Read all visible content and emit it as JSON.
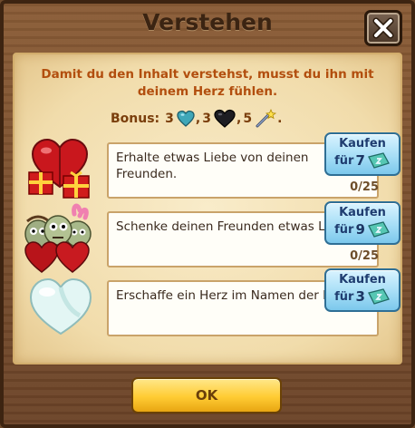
{
  "dialog": {
    "title": "Verstehen",
    "close_icon": "close-icon",
    "intro_text": "Damit du den Inhalt verstehst, musst du ihn mit deinem Herz fühlen.",
    "bonus": {
      "label": "Bonus:",
      "items": [
        {
          "amount": "3",
          "icon": "blue-heart-icon"
        },
        {
          "amount": "3",
          "icon": "black-heart-icon"
        },
        {
          "amount": "5",
          "icon": "magic-wand-icon"
        }
      ],
      "separator": ",",
      "end": "."
    },
    "tasks": [
      {
        "description": "Erhalte etwas Liebe von deinen Freunden.",
        "buy_label": "Kaufen",
        "buy_for": "für",
        "price": "7",
        "currency_icon": "cash-ticket-icon",
        "progress": "0/25",
        "icon": "hearts-gifts-icon"
      },
      {
        "description": "Schenke deinen Freunden etwas Liebe.",
        "buy_label": "Kaufen",
        "buy_for": "für",
        "price": "9",
        "currency_icon": "cash-ticket-icon",
        "progress": "0/25",
        "icon": "zombie-friends-icon"
      },
      {
        "description": "Erschaffe ein Herz im Namen der Liebe.",
        "buy_label": "Kaufen",
        "buy_for": "für",
        "price": "3",
        "currency_icon": "cash-ticket-icon",
        "progress": "",
        "icon": "white-heart-icon"
      }
    ],
    "ok_label": "OK"
  }
}
